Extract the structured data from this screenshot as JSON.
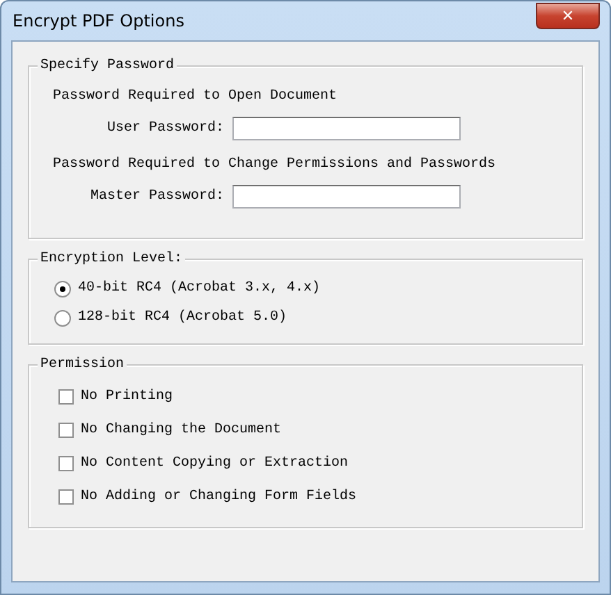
{
  "window": {
    "title": "Encrypt PDF Options",
    "close": "✕"
  },
  "specify_password": {
    "title": "Specify Password",
    "fields": [
      {
        "heading": "Password Required to Open Document",
        "label": "User Password:"
      },
      {
        "heading": "Password Required to Change Permissions and Passwords",
        "label": "Master Password:"
      }
    ]
  },
  "encryption_level": {
    "title": "Encryption Level:",
    "options": [
      {
        "label": "40-bit RC4 (Acrobat 3.x, 4.x)",
        "selected": true
      },
      {
        "label": "128-bit RC4 (Acrobat 5.0)",
        "selected": false
      }
    ]
  },
  "permission": {
    "title": "Permission",
    "options": [
      {
        "label": "No Printing",
        "checked": false
      },
      {
        "label": "No Changing the Document",
        "checked": false
      },
      {
        "label": "No Content Copying or Extraction",
        "checked": false
      },
      {
        "label": "No Adding or Changing Form Fields",
        "checked": false
      }
    ]
  }
}
